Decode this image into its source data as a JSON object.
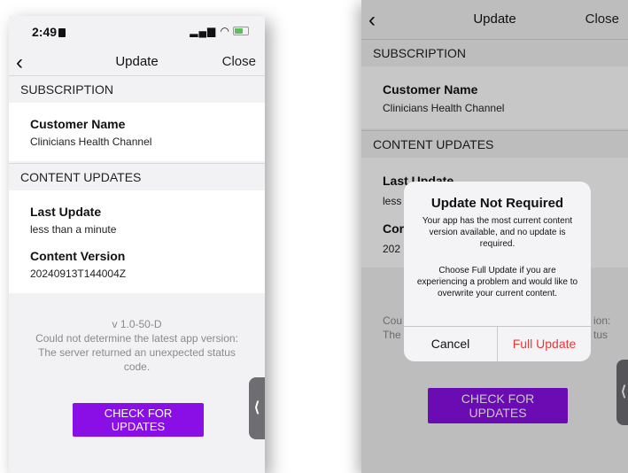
{
  "left_screen": {
    "status": {
      "time": "2:49",
      "signal": "▂▄▆ ◠"
    },
    "nav": {
      "back": "‹",
      "title": "Update",
      "close": "Close"
    },
    "subscription_header": "SUBSCRIPTION",
    "customer_label": "Customer Name",
    "customer_value": "Clinicians Health Channel",
    "content_updates_header": "CONTENT UPDATES",
    "last_update_label": "Last Update",
    "last_update_value": "less than a minute",
    "content_version_label": "Content Version",
    "content_version_value": "20240913T144004Z",
    "version_line": "v 1.0-50-D",
    "error_line1": "Could not determine the latest app version:",
    "error_line2": "The server returned an unexpected status",
    "error_line3": "code.",
    "check_button": "CHECK FOR UPDATES",
    "side_tab": "⟨"
  },
  "right_screen": {
    "nav": {
      "back": "‹",
      "title": "Update",
      "close": "Close"
    },
    "subscription_header": "SUBSCRIPTION",
    "customer_label": "Customer Name",
    "customer_value": "Clinicians Health Channel",
    "content_updates_header": "CONTENT UPDATES",
    "last_update_label": "Last Update",
    "last_update_value": "less",
    "content_label_partial": "Cor",
    "content_value_partial": "202",
    "bg_partial_left1": "Cou",
    "bg_partial_left2": "The",
    "bg_partial_right1": "ion:",
    "bg_partial_right2": "tus",
    "check_button": "CHECK FOR UPDATES",
    "side_tab": "⟨",
    "alert": {
      "title": "Update Not Required",
      "message": "Your app has the most current content version available, and no update is required.",
      "message2": "Choose Full Update if you are experiencing a problem and would like to overwrite your current content.",
      "cancel": "Cancel",
      "full_update": "Full Update"
    }
  },
  "colors": {
    "accent_purple": "#8a0fe6",
    "destructive_red": "#e23b3b",
    "background": "#f2f2f4"
  }
}
